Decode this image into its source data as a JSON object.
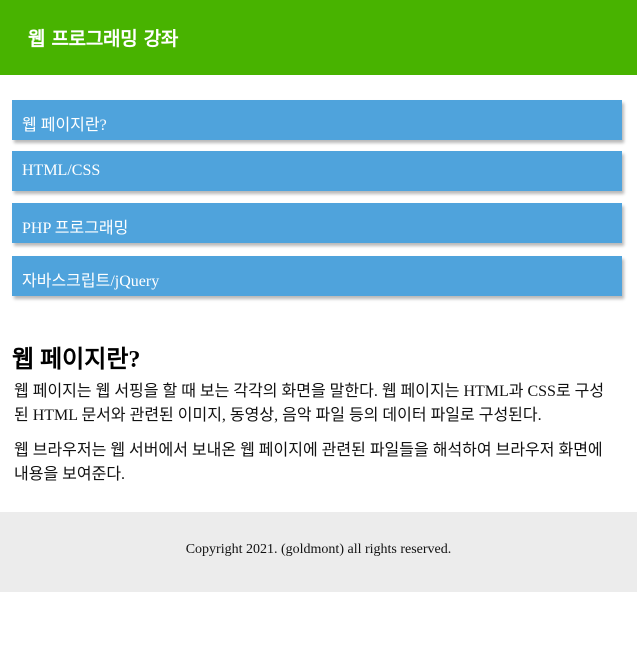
{
  "header": {
    "title": "웹 프로그래밍 강좌"
  },
  "nav": {
    "items": [
      {
        "label": "웹 페이지란?"
      },
      {
        "label": "HTML/CSS"
      },
      {
        "label": "PHP 프로그래밍"
      },
      {
        "label": "자바스크립트/jQuery"
      }
    ]
  },
  "main": {
    "title": "웹 페이지란?",
    "paragraphs": [
      "웹 페이지는 웹 서핑을 할 때 보는 각각의 화면을 말한다. 웹 페이지는 HTML과 CSS로 구성된 HTML 문서와 관련된 이미지, 동영상, 음악 파일 등의 데이터 파일로 구성된다.",
      "웹 브라우저는 웹 서버에서 보내온 웹 페이지에 관련된 파일들을 해석하여 브라우저 화면에 내용을 보여준다."
    ]
  },
  "footer": {
    "copyright": "Copyright 2021. (goldmont) all rights reserved."
  },
  "colors": {
    "header_bg": "#48b300",
    "nav_bg": "#4fa3dc",
    "footer_bg": "#ececec"
  }
}
